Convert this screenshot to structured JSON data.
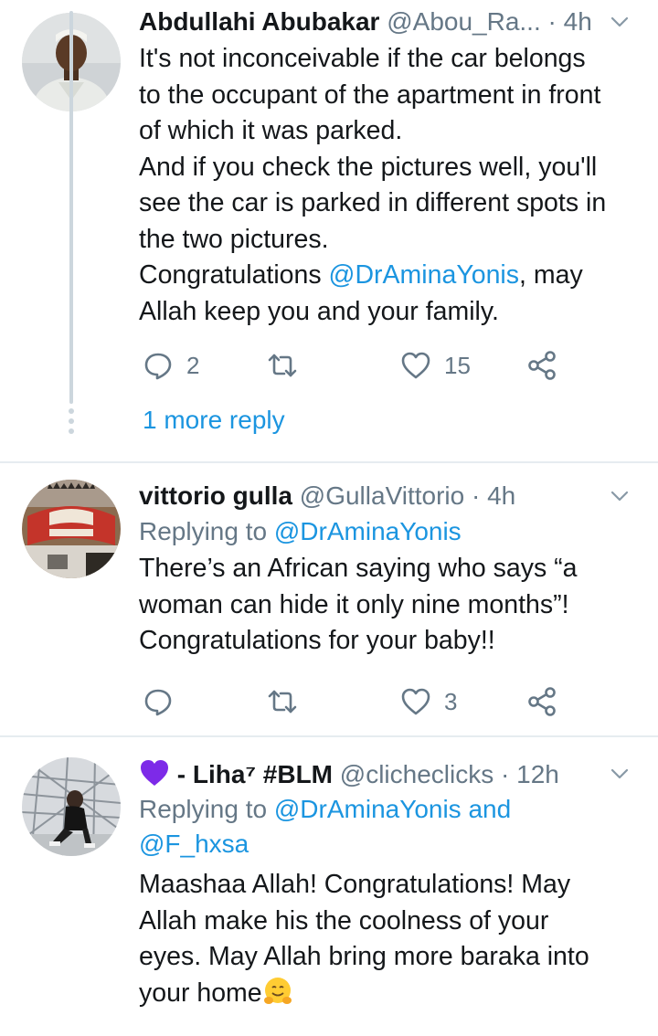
{
  "tweets": [
    {
      "name": "Abdullahi Abubakar",
      "handle": "@Abou_Ra...",
      "dot": "·",
      "time": "4h",
      "lines": [
        "It's not inconceivable if the car belongs",
        "to the occupant of the apartment in front",
        "of which it was parked.",
        "And if you check the pictures well, you'll",
        "see the car is parked in different spots in",
        "the two pictures."
      ],
      "congrats_prefix": "Congratulations ",
      "congrats_mention": "@DrAminaYonis",
      "congrats_suffix": ", may",
      "last_line": "Allah keep you and your family.",
      "replies": "2",
      "retweets": "",
      "likes": "15",
      "more_reply": "1 more reply"
    },
    {
      "name": "vittorio gulla",
      "handle": "@GullaVittorio",
      "dot": "·",
      "time": "4h",
      "replying_prefix": "Replying to ",
      "replying_mention": "@DrAminaYonis",
      "lines": [
        "There’s an African saying who says “a",
        "woman can hide it only nine months”!",
        "Congratulations for your baby!!"
      ],
      "replies": "",
      "retweets": "",
      "likes": "3"
    },
    {
      "name_emoji": "💜",
      "name": " - Liha⁷ #BLM",
      "handle": "@clicheclicks",
      "dot": "·",
      "time": "12h",
      "replying_prefix": "Replying to ",
      "replying_mention": "@DrAminaYonis",
      "replying_and": " and",
      "replying_mention2": "@F_hxsa",
      "lines": [
        "Maashaa Allah! Congratulations! May",
        "Allah make his the coolness of your",
        "eyes. May Allah bring more baraka into"
      ],
      "last_line": "your home",
      "last_emoji": "🤗"
    }
  ],
  "colors": {
    "link": "#1b95e0",
    "muted": "#657786",
    "divider": "#e6ecf0",
    "thread": "#ccd6dd",
    "heart": "#7d2ae8"
  },
  "icons": [
    "reply-icon",
    "retweet-icon",
    "like-icon",
    "share-icon",
    "chevron-down-icon",
    "purple-heart-emoji",
    "hugging-face-emoji"
  ]
}
